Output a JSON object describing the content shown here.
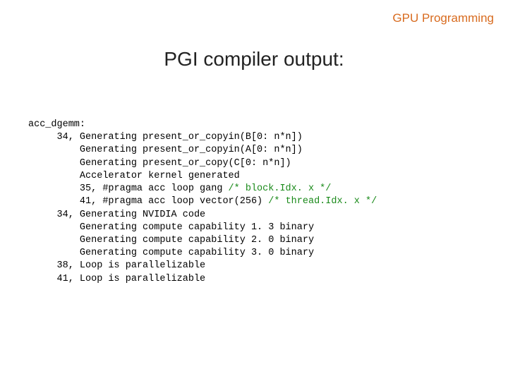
{
  "header": "GPU Programming",
  "title": "PGI compiler output:",
  "code": {
    "l1": "acc_dgemm:",
    "l2": "     34, Generating present_or_copyin(B[0: n*n])",
    "l3": "         Generating present_or_copyin(A[0: n*n])",
    "l4": "         Generating present_or_copy(C[0: n*n])",
    "l5": "         Accelerator kernel generated",
    "l6a": "         35, #pragma acc loop gang ",
    "l6b": "/* block.Idx. x */",
    "l7a": "         41, #pragma acc loop vector(256) ",
    "l7b": "/* thread.Idx. x */",
    "l8": "     34, Generating NVIDIA code",
    "l9": "         Generating compute capability 1. 3 binary",
    "l10": "         Generating compute capability 2. 0 binary",
    "l11": "         Generating compute capability 3. 0 binary",
    "l12": "     38, Loop is parallelizable",
    "l13": "     41, Loop is parallelizable"
  }
}
